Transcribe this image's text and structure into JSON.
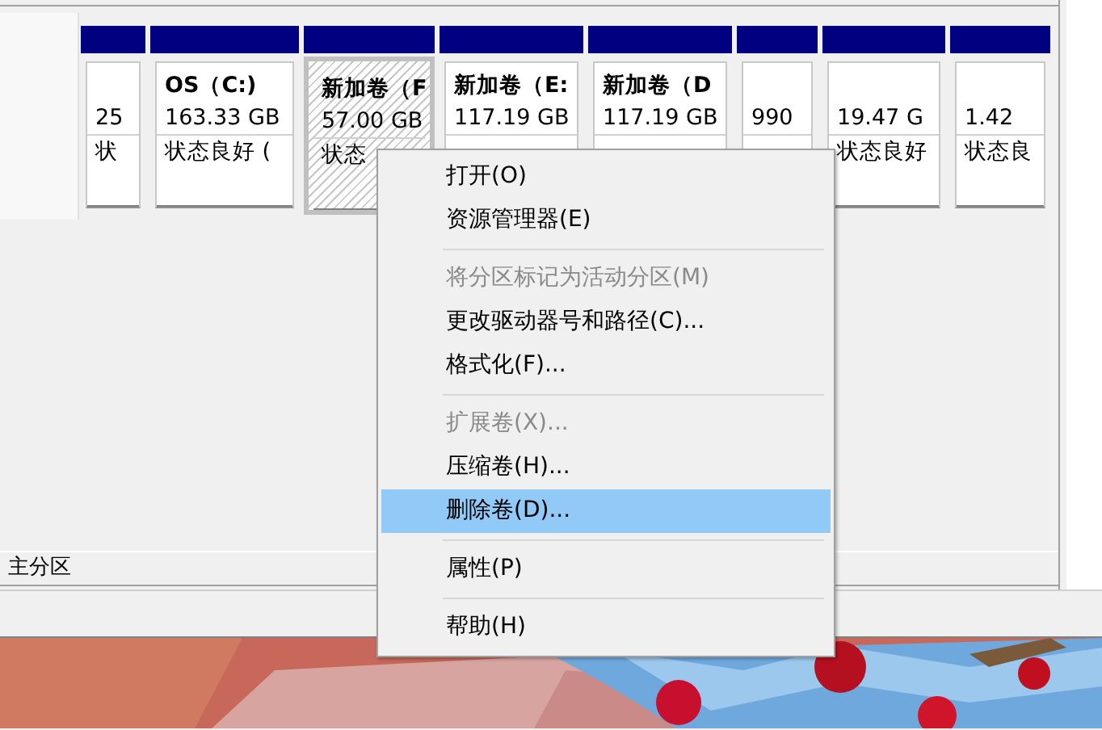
{
  "disk_map": {
    "partitions": [
      {
        "size": "25",
        "status": "状",
        "selected": false
      },
      {
        "label": "OS（C:)",
        "size": "163.33 GB",
        "status": "状态良好 (",
        "selected": false
      },
      {
        "label": "新加卷（F",
        "size": "57.00 GB",
        "status": "状态",
        "selected": true
      },
      {
        "label": "新加卷（E:",
        "size": "117.19 GB",
        "selected": false
      },
      {
        "label": "新加卷（D",
        "size": "117.19 GB",
        "selected": false
      },
      {
        "size": "990",
        "selected": false
      },
      {
        "size": "19.47 G",
        "status": "状态良好",
        "selected": false
      },
      {
        "size": "1.42",
        "status": "状态良",
        "selected": false
      }
    ]
  },
  "legend": {
    "label": "主分区"
  },
  "context_menu": {
    "items": [
      {
        "kind": "item",
        "label": "打开(O)",
        "disabled": false,
        "selected": false
      },
      {
        "kind": "item",
        "label": "资源管理器(E)",
        "disabled": false,
        "selected": false
      },
      {
        "kind": "separator"
      },
      {
        "kind": "item",
        "label": "将分区标记为活动分区(M)",
        "disabled": true,
        "selected": false
      },
      {
        "kind": "item",
        "label": "更改驱动器号和路径(C)...",
        "disabled": false,
        "selected": false
      },
      {
        "kind": "item",
        "label": "格式化(F)...",
        "disabled": false,
        "selected": false
      },
      {
        "kind": "separator"
      },
      {
        "kind": "item",
        "label": "扩展卷(X)...",
        "disabled": true,
        "selected": false
      },
      {
        "kind": "item",
        "label": "压缩卷(H)...",
        "disabled": false,
        "selected": false
      },
      {
        "kind": "item",
        "label": "删除卷(D)...",
        "disabled": false,
        "selected": true
      },
      {
        "kind": "separator"
      },
      {
        "kind": "item",
        "label": "属性(P)",
        "disabled": false,
        "selected": false
      },
      {
        "kind": "separator"
      },
      {
        "kind": "item",
        "label": "帮助(H)",
        "disabled": false,
        "selected": false
      }
    ]
  }
}
